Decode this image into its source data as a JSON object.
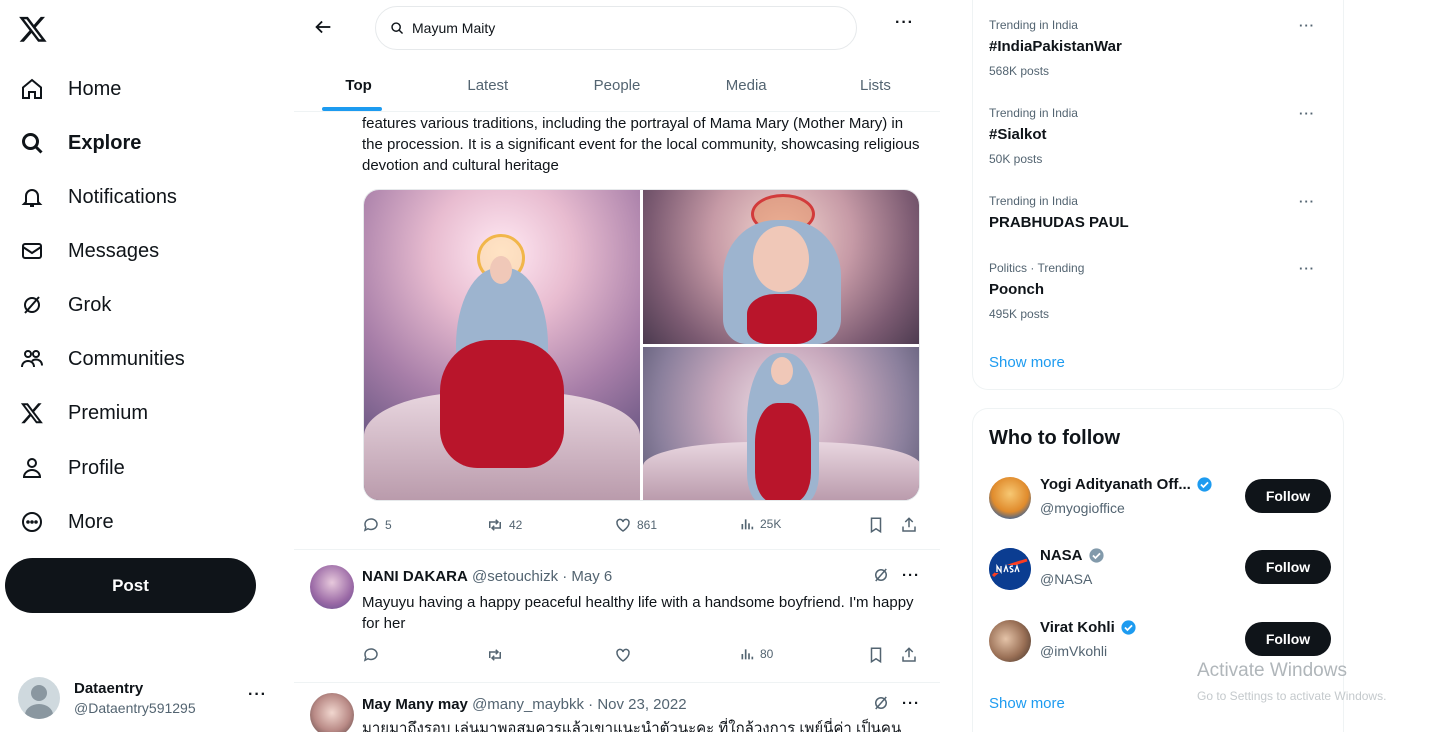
{
  "nav": {
    "items": [
      {
        "label": "Home",
        "icon": "home-icon"
      },
      {
        "label": "Explore",
        "icon": "search-icon",
        "active": true
      },
      {
        "label": "Notifications",
        "icon": "bell-icon"
      },
      {
        "label": "Messages",
        "icon": "envelope-icon"
      },
      {
        "label": "Grok",
        "icon": "grok-icon"
      },
      {
        "label": "Communities",
        "icon": "people-icon"
      },
      {
        "label": "Premium",
        "icon": "x-logo-icon"
      },
      {
        "label": "Profile",
        "icon": "person-icon"
      },
      {
        "label": "More",
        "icon": "more-circle-icon"
      }
    ],
    "post_label": "Post"
  },
  "account": {
    "name": "Dataentry",
    "handle": "@Dataentry591295",
    "more": "···"
  },
  "search": {
    "value": "Mayum Maity",
    "more": "···"
  },
  "tabs": [
    "Top",
    "Latest",
    "People",
    "Media",
    "Lists"
  ],
  "post1": {
    "text": "features various traditions, including the portrayal of Mama Mary (Mother Mary) in the procession. It is a significant event for the local community, showcasing religious devotion and cultural heritage",
    "replies": "5",
    "reposts": "42",
    "likes": "861",
    "views": "25K"
  },
  "reply1": {
    "name": "NANI DAKARA",
    "handle": "@setouchizk · May 6",
    "text": "Mayuyu having a happy peaceful healthy life with a handsome boyfriend. I'm happy for her",
    "views": "80",
    "more": "···"
  },
  "reply2": {
    "name": "May Many may",
    "handle": "@many_maybkk · Nov 23, 2022",
    "text": "มายุมาถึงรอบ เล่นมาพอสมควรแล้วเขาแนะนำตัวนะคะ ที่ใกล้วงการ เพย์นี่ค่า เป็นคน",
    "more": "···"
  },
  "trends": [
    {
      "category": "Trending in India",
      "title": "#IndiaPakistanWar",
      "count": "568K posts"
    },
    {
      "category": "Trending in India",
      "title": "#Sialkot",
      "count": "50K posts"
    },
    {
      "category": "Trending in India",
      "title": "PRABHUDAS PAUL",
      "count": ""
    },
    {
      "category": "Politics · Trending",
      "title": "Poonch",
      "count": "495K posts"
    }
  ],
  "trend_more": "···",
  "trends_show_more": "Show more",
  "who_to_follow": {
    "title": "Who to follow",
    "accounts": [
      {
        "name": "Yogi Adityanath Off...",
        "handle": "@myogioffice",
        "verified": "blue"
      },
      {
        "name": "NASA",
        "handle": "@NASA",
        "verified": "gray"
      },
      {
        "name": "Virat Kohli",
        "handle": "@imVkohli",
        "verified": "blue"
      }
    ],
    "follow_label": "Follow",
    "show_more": "Show more"
  },
  "watermark": {
    "title": "Activate Windows",
    "subtitle": "Go to Settings to activate Windows."
  },
  "colors": {
    "accent": "#1d9bf0",
    "text": "#0f1419",
    "muted": "#536471",
    "button": "#0f1419"
  }
}
